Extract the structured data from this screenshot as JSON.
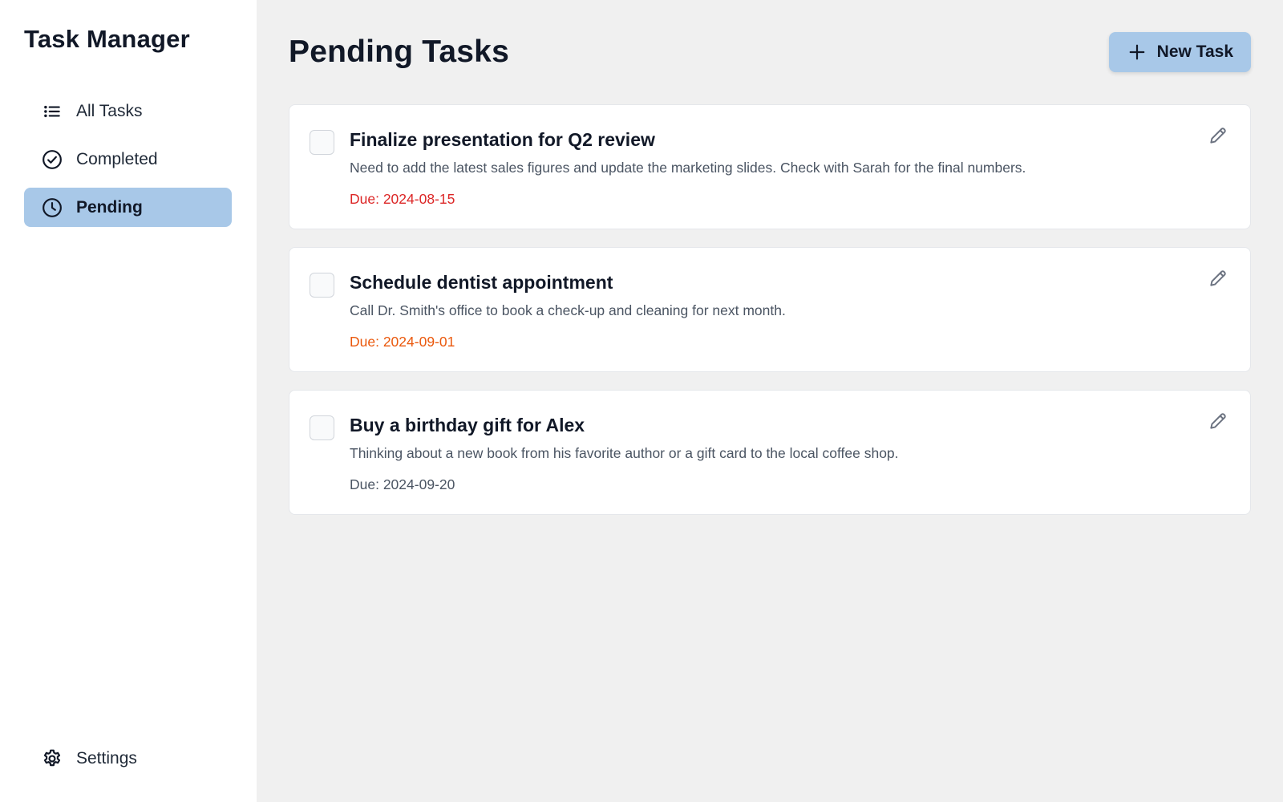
{
  "app": {
    "title": "Task Manager"
  },
  "sidebar": {
    "items": [
      {
        "label": "All Tasks",
        "icon": "list-icon",
        "active": false
      },
      {
        "label": "Completed",
        "icon": "check-circle-icon",
        "active": false
      },
      {
        "label": "Pending",
        "icon": "clock-icon",
        "active": true
      }
    ],
    "settings": {
      "label": "Settings",
      "icon": "gear-icon"
    }
  },
  "main": {
    "title": "Pending Tasks",
    "new_task_label": "New Task",
    "tasks": [
      {
        "title": "Finalize presentation for Q2 review",
        "description": "Need to add the latest sales figures and update the marketing slides. Check with Sarah for the final numbers.",
        "due": "Due: 2024-08-15",
        "due_color": "#dc2626",
        "checked": false
      },
      {
        "title": "Schedule dentist appointment",
        "description": "Call Dr. Smith's office to book a check-up and cleaning for next month.",
        "due": "Due: 2024-09-01",
        "due_color": "#ea580c",
        "checked": false
      },
      {
        "title": "Buy a birthday gift for Alex",
        "description": "Thinking about a new book from his favorite author or a gift card to the local coffee shop.",
        "due": "Due: 2024-09-20",
        "due_color": "#4b5563",
        "checked": false
      }
    ]
  },
  "colors": {
    "accent": "#a8c8e8",
    "background": "#f0f0f0",
    "overdue": "#dc2626",
    "upcoming": "#ea580c"
  }
}
